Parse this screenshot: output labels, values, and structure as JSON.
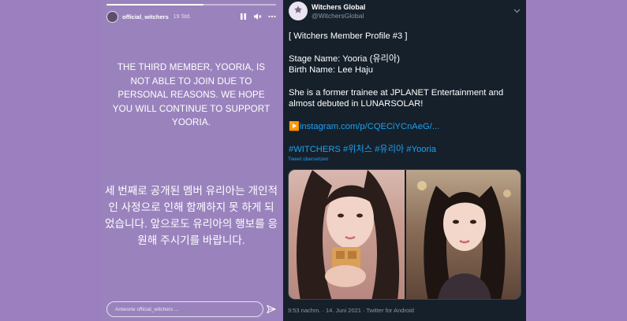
{
  "story": {
    "username": "official_witchers",
    "time": "19 Std.",
    "progress_fraction": 0.57,
    "message_en": "THE THIRD MEMBER, YOORIA, IS NOT ABLE TO JOIN DUE TO PERSONAL REASONS. WE HOPE YOU WILL CONTINUE TO SUPPORT YOORIA.",
    "message_ko": "세 번째로 공개된 멤버 유리아는 개인적인 사정으로 인해 함께하지 못 하게 되었습니다. 앞으로도 유리아의 행보를 응원해 주시기를 바랍니다.",
    "reply_placeholder": "Antworte official_witchers ...",
    "icons": [
      "pause-icon",
      "mute-icon",
      "more-icon",
      "send-icon"
    ]
  },
  "tweet": {
    "display_name": "Witchers Global",
    "handle": "@WitchersGlobal",
    "avatar_text": "WITCHERS",
    "line_title": "[ Witchers Member Profile #3 ]",
    "line_stage": "Stage Name: Yooria (유리아)",
    "line_birth": "Birth Name: Lee Haju",
    "line_bio1": "She is a former trainee at JPLANET Entertainment and",
    "line_bio2": "almost debuted in LUNARSOLAR!",
    "link_icon": "▶️",
    "link_text": "instagram.com/p/CQECiYCnAeG/...",
    "hashtags": "#WITCHERS #위처스 #유리아 #Yooria",
    "translate": "Tweet übersetzen",
    "meta": "9:53 nachm. · 14. Juni 2021 · Twitter for Android",
    "accent_color": "#1da1f2",
    "icons": [
      "chevron-down-icon"
    ]
  }
}
